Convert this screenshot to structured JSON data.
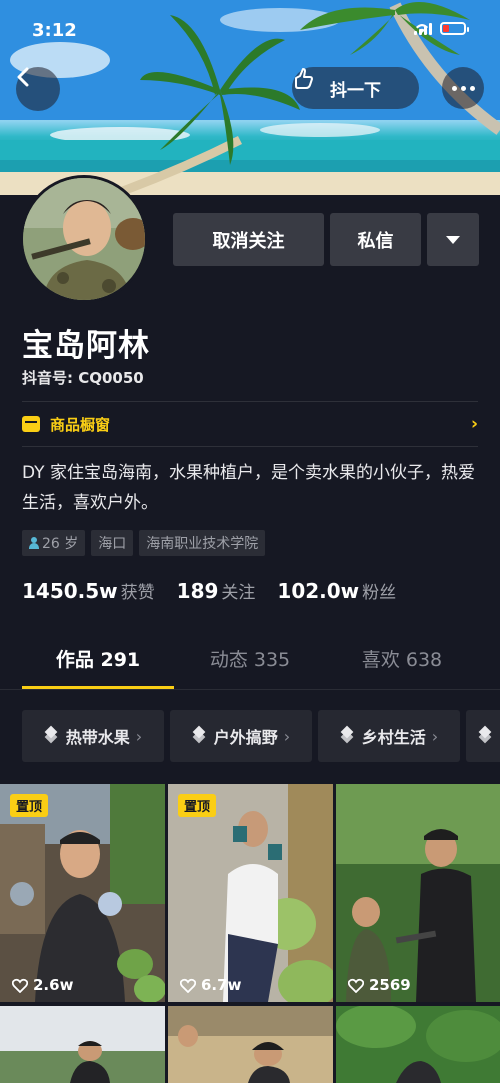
{
  "status_bar": {
    "time": "3:12"
  },
  "header": {
    "shake_label": "抖一下"
  },
  "profile": {
    "name": "宝岛阿林",
    "douyin_id": "抖音号: CQ0050",
    "unfollow_label": "取消关注",
    "message_label": "私信",
    "shop_label": "商品橱窗",
    "bio": "DY 家住宝岛海南，水果种植户，是个卖水果的小伙子，热爱生活，喜欢户外。",
    "tags": [
      "26 岁",
      "海口",
      "海南职业技术学院"
    ],
    "stats": [
      {
        "num": "1450.5w",
        "label": "获赞"
      },
      {
        "num": "189",
        "label": "关注"
      },
      {
        "num": "102.0w",
        "label": "粉丝"
      }
    ]
  },
  "tabs": [
    {
      "label": "作品 291"
    },
    {
      "label": "动态 335"
    },
    {
      "label": "喜欢 638"
    }
  ],
  "collections": [
    "热带水果",
    "户外搞野",
    "乡村生活"
  ],
  "videos": [
    {
      "pinned_label": "置顶",
      "likes": "2.6w"
    },
    {
      "pinned_label": "置顶",
      "likes": "6.7w"
    },
    {
      "pinned_label": "",
      "likes": "2569"
    }
  ],
  "colors": {
    "background": "#161823",
    "accent": "#face15",
    "button": "#393b44"
  }
}
